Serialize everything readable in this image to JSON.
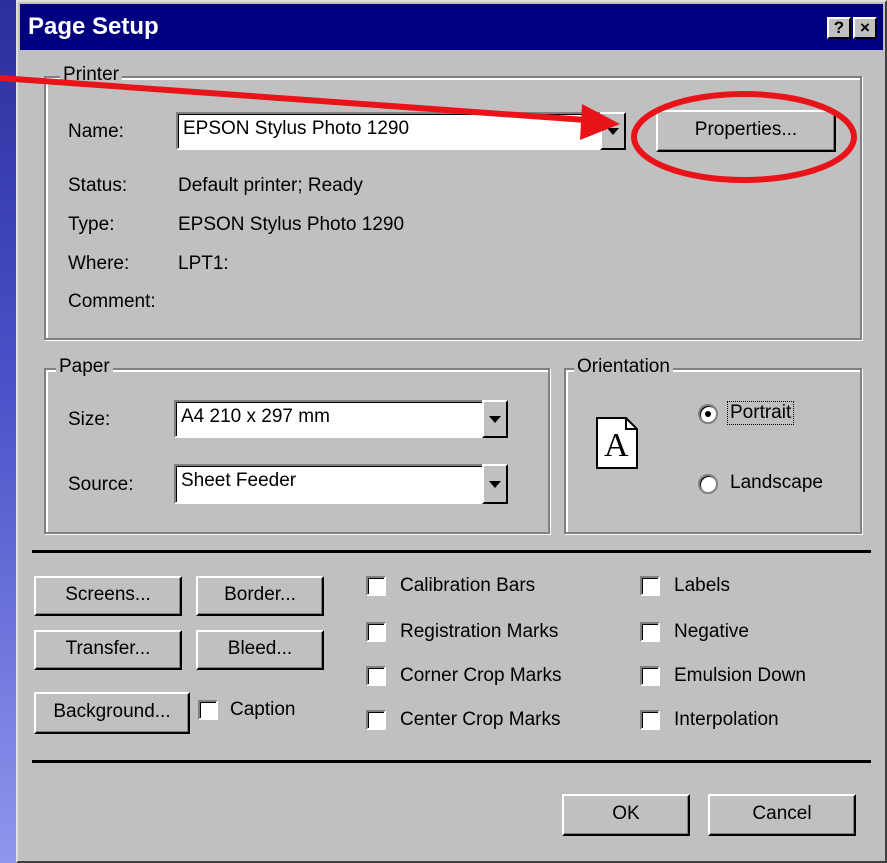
{
  "title": "Page Setup",
  "titlebar_buttons": {
    "help": "?",
    "close": "×"
  },
  "printer": {
    "legend": "Printer",
    "name_label": "Name:",
    "name_value": "EPSON Stylus Photo 1290",
    "properties_label": "Properties...",
    "status_label": "Status:",
    "status_value": "Default printer; Ready",
    "type_label": "Type:",
    "type_value": "EPSON Stylus Photo 1290",
    "where_label": "Where:",
    "where_value": "LPT1:",
    "comment_label": "Comment:"
  },
  "paper": {
    "legend": "Paper",
    "size_label": "Size:",
    "size_value": "A4 210 x 297 mm",
    "source_label": "Source:",
    "source_value": "Sheet Feeder"
  },
  "orientation": {
    "legend": "Orientation",
    "icon_letter": "A",
    "portrait": "Portrait",
    "landscape": "Landscape",
    "selected": "portrait"
  },
  "buttons": {
    "screens": "Screens...",
    "border": "Border...",
    "transfer": "Transfer...",
    "bleed": "Bleed...",
    "background": "Background...",
    "ok": "OK",
    "cancel": "Cancel"
  },
  "checkboxes": {
    "caption": "Caption",
    "calibration_bars": "Calibration Bars",
    "registration_marks": "Registration Marks",
    "corner_crop_marks": "Corner Crop Marks",
    "center_crop_marks": "Center Crop Marks",
    "labels": "Labels",
    "negative": "Negative",
    "emulsion_down": "Emulsion Down",
    "interpolation": "Interpolation"
  },
  "annotation": {
    "color": "#e8141a"
  }
}
